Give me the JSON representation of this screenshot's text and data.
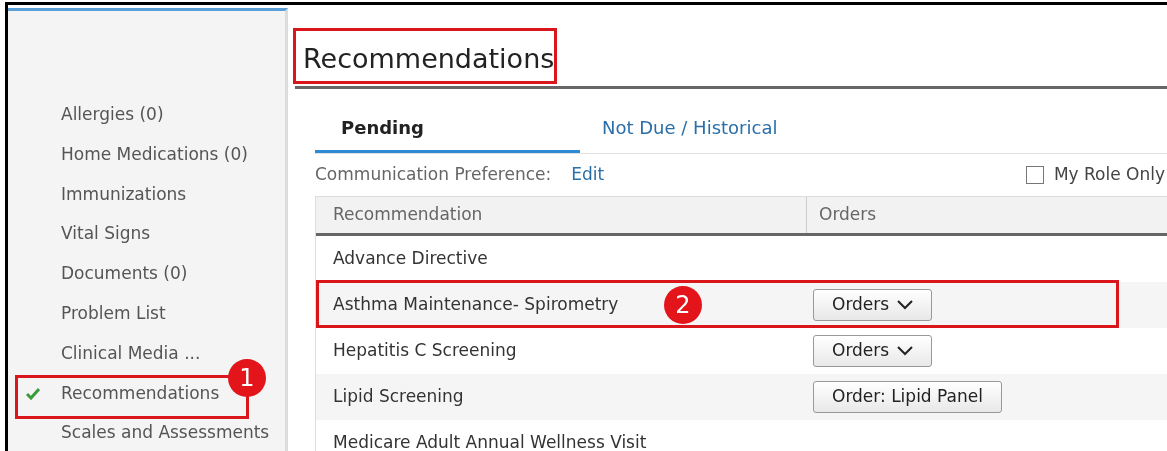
{
  "sidebar": {
    "items": [
      {
        "label": "Allergies (0)",
        "selected": false
      },
      {
        "label": "Home Medications (0)",
        "selected": false
      },
      {
        "label": "Immunizations",
        "selected": false
      },
      {
        "label": "Vital Signs",
        "selected": false
      },
      {
        "label": "Documents (0)",
        "selected": false
      },
      {
        "label": "Problem List",
        "selected": false
      },
      {
        "label": "Clinical Media ...",
        "selected": false
      },
      {
        "label": "Recommendations",
        "selected": true,
        "callout": "1"
      },
      {
        "label": "Scales and Assessments",
        "selected": false
      }
    ]
  },
  "title": {
    "text": "Recommendations",
    "framed": true
  },
  "tabs": [
    {
      "label": "Pending",
      "selected": true
    },
    {
      "label": "Not Due / Historical",
      "selected": false
    }
  ],
  "communication": {
    "label": "Communication Preference:",
    "link": "Edit"
  },
  "my_role_only": {
    "label": "My Role Only",
    "checked": false
  },
  "table": {
    "columns": [
      "Recommendation",
      "Orders"
    ],
    "rows": [
      {
        "name": "Advance Directive"
      },
      {
        "name": "Asthma Maintenance- Spirometry",
        "order": {
          "label": "Orders",
          "kind": "dropdown"
        },
        "callout": "2"
      },
      {
        "name": "Hepatitis C Screening",
        "order": {
          "label": "Orders",
          "kind": "dropdown"
        }
      },
      {
        "name": "Lipid Screening",
        "order": {
          "label": "Order: Lipid Panel",
          "kind": "plain"
        }
      },
      {
        "name": "Medicare Adult Annual Wellness Visit"
      }
    ]
  }
}
